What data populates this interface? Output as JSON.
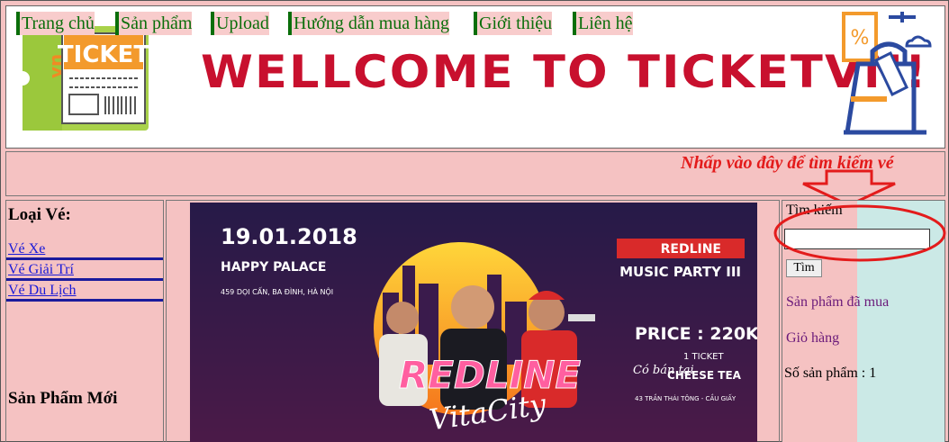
{
  "banner": {
    "logo_text": "TICKET",
    "logo_side": "vn",
    "welcome": "WELLCOME TO TICKETVN!"
  },
  "nav": {
    "items": [
      {
        "label": "Trang chủ"
      },
      {
        "label": "Sản phẩm"
      },
      {
        "label": "Upload"
      },
      {
        "label": "Hướng dẫn mua hàng"
      },
      {
        "label": "Giới thiệu"
      },
      {
        "label": "Liên hệ"
      }
    ],
    "hint": "Nhấp vào đây để tìm kiếm vé"
  },
  "left": {
    "title": "Loại Vé:",
    "categories": [
      {
        "label": "Vé Xe"
      },
      {
        "label": "Vé Giải Trí"
      },
      {
        "label": "Vé Du Lịch"
      }
    ],
    "new_products": "Sản Phẩm Mới"
  },
  "poster": {
    "date": "19.01.2018",
    "venue": "HAPPY PALACE",
    "address": "459 DỌI CẤN, BA ĐÌNH, HÀ NỘI",
    "badge": "REDLINE",
    "event": "MUSIC PARTY III",
    "price": "PRICE : 220K",
    "sell_at": "Có bán tại",
    "ticket_count": "1 TICKET",
    "shop": "CHEESE TEA",
    "shop_address": "43 TRẦN THÁI TÔNG - CẦU GIẤY",
    "logo_top": "REDLINE",
    "logo_bottom": "VitaCity"
  },
  "right": {
    "search_label": "Tìm kiếm",
    "search_value": "",
    "search_button": "Tìm",
    "purchased": "Sản phẩm đã mua",
    "cart": "Giỏ hàng",
    "count": "Số sản phẩm : 1"
  },
  "colors": {
    "background": "#f5c2c2",
    "nav_green": "#0a6e0a",
    "welcome_red": "#c8102e",
    "hint_red": "#e31b1b",
    "link_blue": "#1a1ad8",
    "link_purple": "#6a1a7a"
  }
}
